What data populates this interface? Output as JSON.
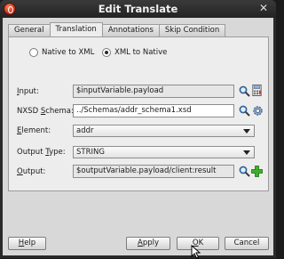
{
  "dialog": {
    "title": "Edit Translate",
    "close": "✕"
  },
  "tabs": [
    {
      "label": "General",
      "active": false
    },
    {
      "label": "Translation",
      "active": true
    },
    {
      "label": "Annotations",
      "active": false
    },
    {
      "label": "Skip Condition",
      "active": false
    }
  ],
  "direction": {
    "options": [
      {
        "label": "Native to XML",
        "selected": false
      },
      {
        "label": "XML to Native",
        "selected": true
      }
    ]
  },
  "form": {
    "input": {
      "label_pre": "",
      "label_key": "I",
      "label_post": "nput:",
      "value": "$inputVariable.payload"
    },
    "nxsd": {
      "label_pre": "NXSD ",
      "label_key": "S",
      "label_post": "chema:",
      "value": "../Schemas/addr_schema1.xsd"
    },
    "element": {
      "label_pre": "",
      "label_key": "E",
      "label_post": "lement:",
      "value": "addr"
    },
    "output_type": {
      "label_pre": "Output ",
      "label_key": "T",
      "label_post": "ype:",
      "value": "STRING"
    },
    "output": {
      "label_pre": "",
      "label_key": "O",
      "label_post": "utput:",
      "value": "$outputVariable.payload/client:result"
    }
  },
  "buttons": {
    "help": {
      "pre": "",
      "key": "H",
      "post": "elp"
    },
    "apply": {
      "pre": "",
      "key": "A",
      "post": "pply"
    },
    "ok": {
      "pre": "",
      "key": "O",
      "post": "K"
    },
    "cancel": {
      "pre": "Cancel",
      "key": "",
      "post": ""
    }
  }
}
